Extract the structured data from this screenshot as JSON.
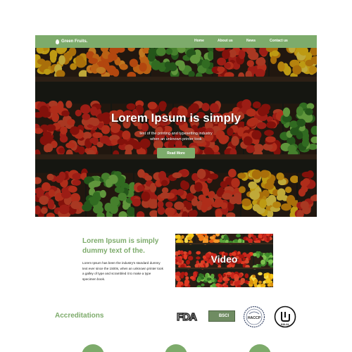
{
  "nav": {
    "brand": "Green Fruits.",
    "links": [
      "Home",
      "About us",
      "News",
      "Contact us"
    ]
  },
  "hero": {
    "title": "Lorem Ipsum is simply",
    "subtitle_lines": [
      "text of the printing and typesetting industry",
      "when an unknown printer took"
    ],
    "button": "Read More"
  },
  "intro": {
    "title": "Lorem Ipsum is simply dummy text of the.",
    "body": "Lorem Ipsum has been the industry's standard dummy text ever since the 1500s, when an unknown printer took a galley of type and scrambled it to make a type specimen book.",
    "video_label": "Video"
  },
  "accreditations": {
    "title": "Accreditations",
    "logos": [
      {
        "name": "FDA",
        "text": "FDA"
      },
      {
        "name": "BSCI",
        "text": "BSCI"
      },
      {
        "name": "HACCP",
        "text": "HACCP"
      },
      {
        "name": "HALAL",
        "text": "HALAL"
      }
    ]
  },
  "colors": {
    "brand_green": "#7dab6b",
    "dark": "#1b1d17"
  }
}
